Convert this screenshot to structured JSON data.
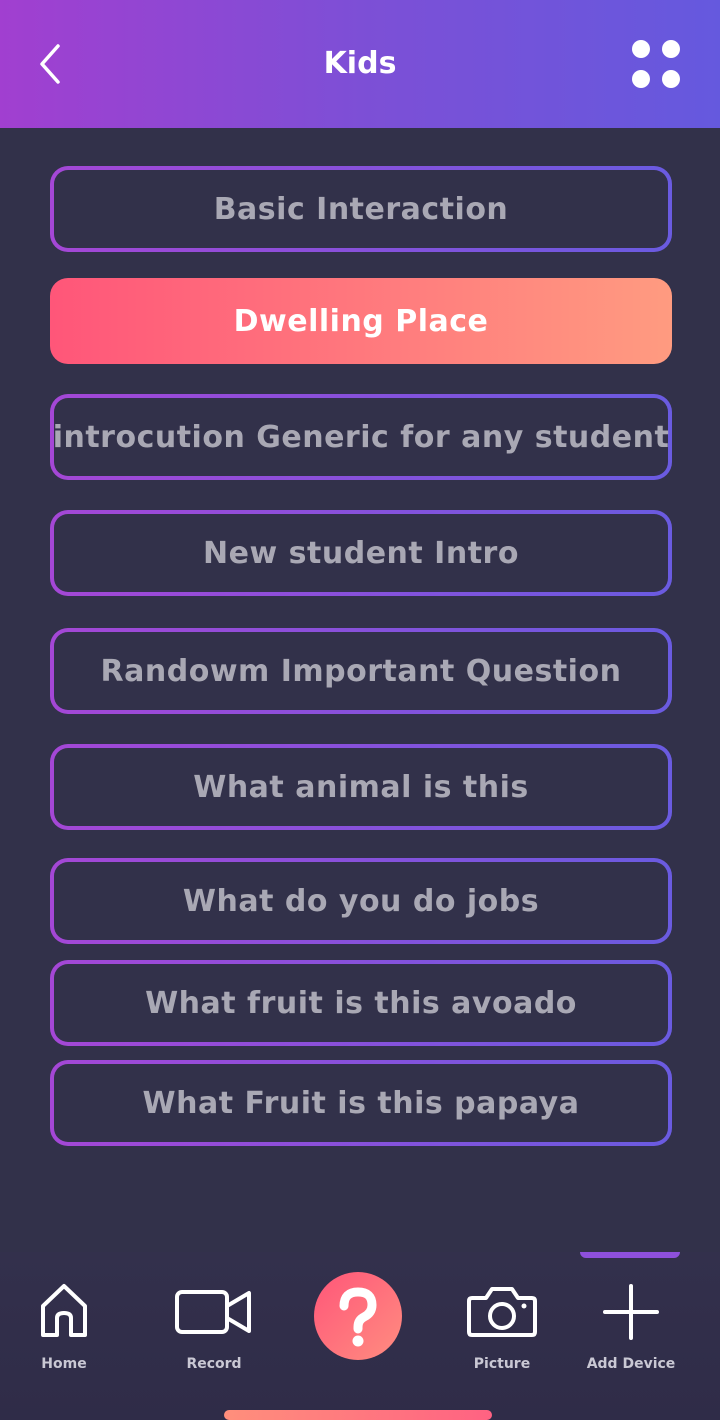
{
  "header": {
    "title": "Kids",
    "back_icon": "chevron-left-icon",
    "menu_icon": "grid-dots-icon"
  },
  "list": {
    "items": [
      {
        "label": "Basic Interaction",
        "active": false
      },
      {
        "label": "Dwelling Place",
        "active": true
      },
      {
        "label": "introcution Generic for any student",
        "active": false
      },
      {
        "label": "New student Intro",
        "active": false
      },
      {
        "label": "Randowm Important Question",
        "active": false
      },
      {
        "label": "What animal is this",
        "active": false
      },
      {
        "label": "What do you do jobs",
        "active": false
      },
      {
        "label": "What fruit is this avoado",
        "active": false
      },
      {
        "label": "What Fruit is this papaya",
        "active": false
      }
    ]
  },
  "bottom_nav": {
    "home_label": "Home",
    "record_label": "Record",
    "help_icon": "question-icon",
    "picture_label": "Picture",
    "add_device_label": "Add Device"
  },
  "colors": {
    "background": "#32314a",
    "header_gradient_start": "#a13fd0",
    "header_gradient_end": "#6559de",
    "active_gradient_start": "#ff5679",
    "active_gradient_end": "#ff9b80",
    "border_gradient_start": "#a447d6",
    "border_gradient_end": "#6a5be0",
    "inactive_text": "#a9a8b4"
  }
}
